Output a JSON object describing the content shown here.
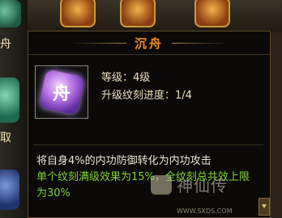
{
  "background": {
    "side_labels": [
      "舟",
      "取"
    ]
  },
  "tooltip": {
    "title": "沉舟",
    "icon_glyph": "舟",
    "level_label": "等级：4级",
    "progress_label": "升级纹刻进度：1/4",
    "description": "将自身4%的内功防御转化为内功攻击",
    "effect_text": "单个纹刻满级效果为15%，全纹刻总共效上限为30%"
  },
  "watermark": {
    "text": "神仙传",
    "url": "WWW.SXDS.COM"
  },
  "colors": {
    "title": "#f08a30",
    "effect": "#7fd23a",
    "text": "#e9e5d8"
  }
}
